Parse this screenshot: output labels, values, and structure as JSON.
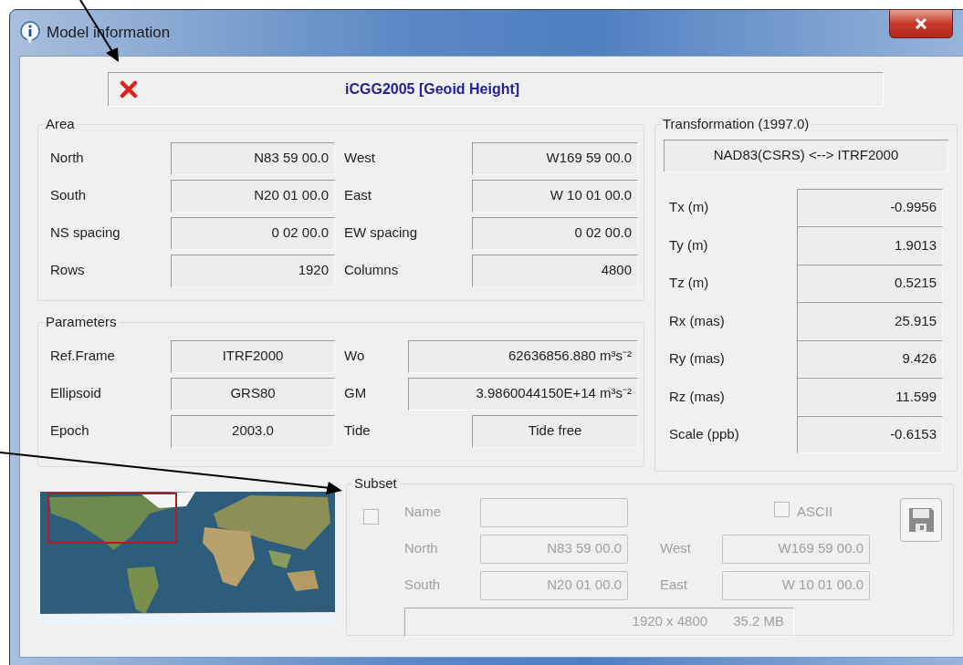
{
  "window": {
    "title": "Model information"
  },
  "model": {
    "name": "iCGG2005 [Geoid Height]"
  },
  "area": {
    "title": "Area",
    "rows": [
      [
        {
          "label": "North",
          "value": "N83 59 00.0"
        },
        {
          "label": "West",
          "value": "W169 59 00.0"
        }
      ],
      [
        {
          "label": "South",
          "value": "N20 01 00.0"
        },
        {
          "label": "East",
          "value": "W 10 01 00.0"
        }
      ],
      [
        {
          "label": "NS spacing",
          "value": "0 02 00.0"
        },
        {
          "label": "EW spacing",
          "value": "0 02 00.0"
        }
      ],
      [
        {
          "label": "Rows",
          "value": "1920"
        },
        {
          "label": "Columns",
          "value": "4800"
        }
      ]
    ]
  },
  "parameters": {
    "title": "Parameters",
    "rows": [
      [
        {
          "label": "Ref.Frame",
          "value": "ITRF2000"
        },
        {
          "label": "Wo",
          "value": "62636856.880 m³s⁻²"
        }
      ],
      [
        {
          "label": "Ellipsoid",
          "value": "GRS80"
        },
        {
          "label": "GM",
          "value": "3.9860044150E+14 m³s⁻²"
        }
      ],
      [
        {
          "label": "Epoch",
          "value": "2003.0"
        },
        {
          "label": "Tide",
          "value": "Tide free"
        }
      ]
    ]
  },
  "transformation": {
    "title": "Transformation (1997.0)",
    "datums": "NAD83(CSRS) <--> ITRF2000",
    "params": [
      {
        "label": "Tx (m)",
        "value": "-0.9956"
      },
      {
        "label": "Ty (m)",
        "value": "1.9013"
      },
      {
        "label": "Tz (m)",
        "value": "0.5215"
      },
      {
        "label": "Rx (mas)",
        "value": "25.915"
      },
      {
        "label": "Ry (mas)",
        "value": "9.426"
      },
      {
        "label": "Rz (mas)",
        "value": "11.599"
      },
      {
        "label": "Scale (ppb)",
        "value": "-0.6153"
      }
    ]
  },
  "subset": {
    "title": "Subset",
    "checked": false,
    "disabled": true,
    "name_label": "Name",
    "rows": [
      [
        {
          "label": "North",
          "value": "N83 59 00.0"
        },
        {
          "label": "West",
          "value": "W169 59 00.0"
        }
      ],
      [
        {
          "label": "South",
          "value": "N20 01 00.0"
        },
        {
          "label": "East",
          "value": "W 10 01 00.0"
        }
      ]
    ],
    "ascii": {
      "label": "ASCII",
      "checked": false
    },
    "size": "1920 x 4800",
    "file_size": "35.2 MB"
  }
}
